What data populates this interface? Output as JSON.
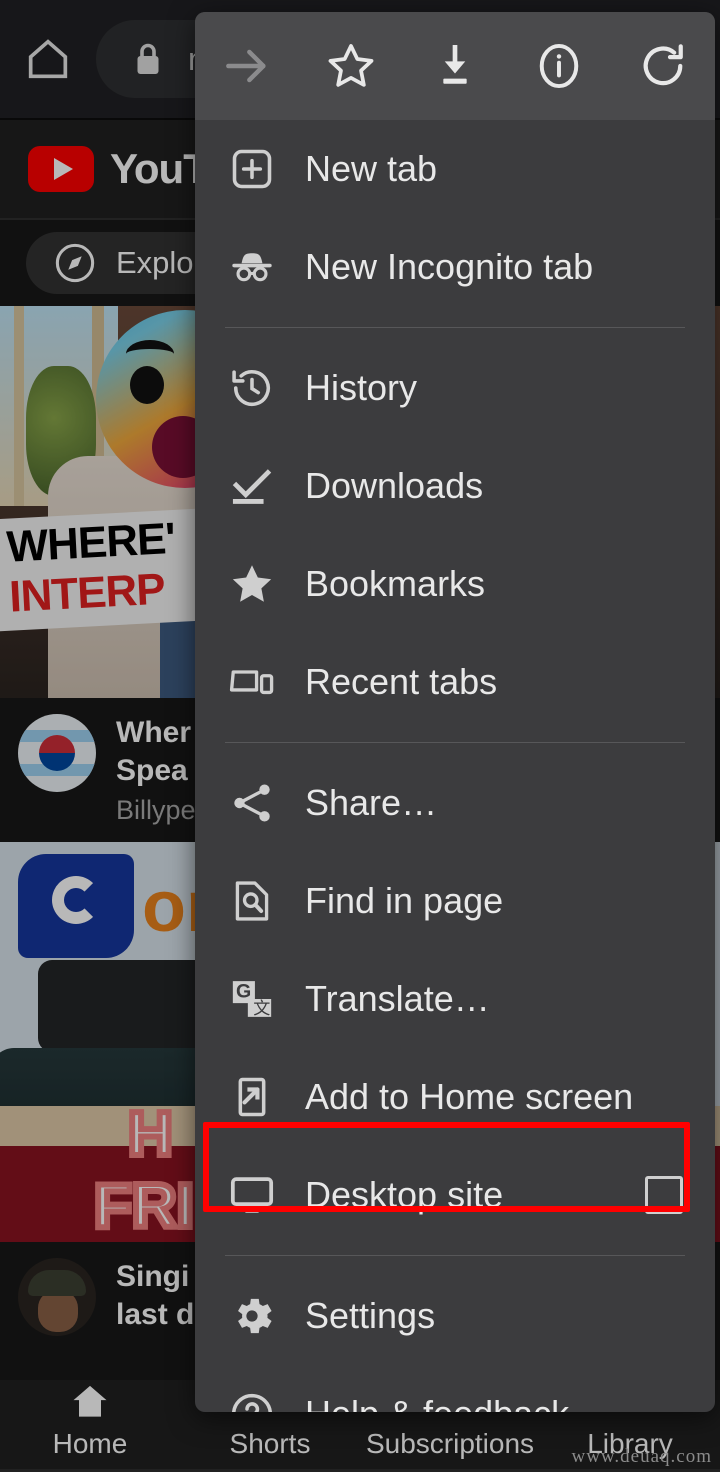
{
  "browser": {
    "home_icon": "home-icon",
    "lock_icon": "lock-icon",
    "url_text": "m",
    "toolbar": [
      {
        "name": "forward-icon",
        "label": "Forward",
        "disabled": true
      },
      {
        "name": "bookmark-star-icon",
        "label": "Bookmark"
      },
      {
        "name": "download-icon",
        "label": "Download page"
      },
      {
        "name": "page-info-icon",
        "label": "Page info"
      },
      {
        "name": "reload-icon",
        "label": "Reload"
      }
    ]
  },
  "menu": {
    "groups": [
      {
        "items": [
          {
            "icon": "new-tab-icon",
            "label": "New tab"
          },
          {
            "icon": "incognito-icon",
            "label": "New Incognito tab"
          }
        ]
      },
      {
        "items": [
          {
            "icon": "history-icon",
            "label": "History"
          },
          {
            "icon": "downloads-check-icon",
            "label": "Downloads"
          },
          {
            "icon": "bookmarks-star-icon",
            "label": "Bookmarks"
          },
          {
            "icon": "recent-tabs-icon",
            "label": "Recent tabs"
          }
        ]
      },
      {
        "items": [
          {
            "icon": "share-icon",
            "label": "Share…"
          },
          {
            "icon": "find-in-page-icon",
            "label": "Find in page"
          },
          {
            "icon": "translate-icon",
            "label": "Translate…"
          },
          {
            "icon": "add-to-home-screen-icon",
            "label": "Add to Home screen"
          },
          {
            "icon": "desktop-site-icon",
            "label": "Desktop site",
            "checkbox": true,
            "checked": false,
            "highlighted": true
          }
        ]
      },
      {
        "items": [
          {
            "icon": "settings-gear-icon",
            "label": "Settings"
          },
          {
            "icon": "help-feedback-icon",
            "label": "Help & feedback"
          }
        ]
      }
    ],
    "highlight_color": "#ff0000"
  },
  "youtube": {
    "brand": "YouTube",
    "chips": [
      {
        "icon": "explore-compass-icon",
        "label": "Explore"
      }
    ],
    "videos": [
      {
        "thumb_text_line1": "WHERE'",
        "thumb_text_line2": "INTERP",
        "title": "Wher\nSpea",
        "channel": "Billype",
        "avatar": "korea-flag-avatar"
      },
      {
        "thumb_logo": "om",
        "thumb_text_line1": "H",
        "thumb_text_line2": "FRIE",
        "title": "Singi\nlast d",
        "channel": "",
        "avatar": "person-bucket-hat-avatar"
      }
    ],
    "bottom_nav": [
      {
        "icon": "home-filled-icon",
        "label": "Home",
        "active": true
      },
      {
        "icon": "shorts-icon",
        "label": "Shorts",
        "active": false
      },
      {
        "icon": "subscriptions-icon",
        "label": "Subscriptions",
        "active": false
      },
      {
        "icon": "library-icon",
        "label": "Library",
        "active": false
      }
    ]
  },
  "watermark": "www.deuaq.com"
}
